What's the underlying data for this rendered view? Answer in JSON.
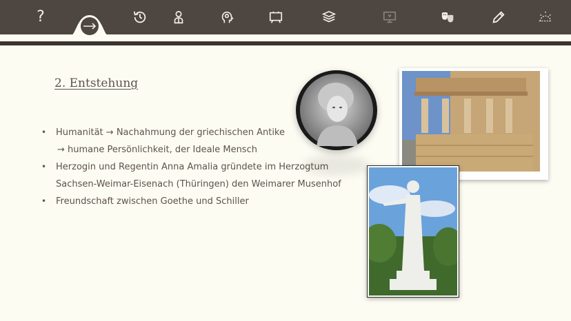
{
  "toolbar": {
    "icons": [
      {
        "name": "help-icon",
        "glyph": "?"
      },
      {
        "name": "next-arrow-icon"
      },
      {
        "name": "history-icon"
      },
      {
        "name": "person-icon"
      },
      {
        "name": "lightbulb-head-icon"
      },
      {
        "name": "presentation-board-icon"
      },
      {
        "name": "layers-stack-icon"
      },
      {
        "name": "monitor-icon"
      },
      {
        "name": "theatre-masks-icon"
      },
      {
        "name": "pencil-icon"
      },
      {
        "name": "sunrise-icon"
      }
    ],
    "colors": {
      "background": "#4e4640",
      "icon": "#f4f0e6",
      "dimmed": "#8a837c"
    }
  },
  "slide": {
    "heading": "2. Entstehung",
    "bullets": [
      {
        "text": "Humanität →  Nachahmung der griechischen Antike",
        "sub": "→  humane Persönlichkeit, der Ideale Mensch"
      },
      {
        "text": "Herzogin und Regentin Anna Amalia gründete im Herzogtum",
        "sub": "Sachsen-Weimar-Eisenach (Thüringen) den Weimarer Musenhof"
      },
      {
        "text": "Freundschaft zwischen Goethe und Schiller"
      }
    ]
  }
}
